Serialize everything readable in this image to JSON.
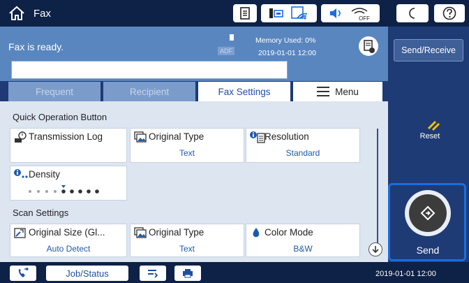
{
  "topbar": {
    "title": "Fax",
    "icons": [
      "home-icon",
      "document-icon",
      "printer-wifi-status-icon",
      "wifi-icon",
      "volume-icon",
      "wifi-off-icon",
      "sleep-moon-icon",
      "help-icon"
    ]
  },
  "status": {
    "message": "Fax is ready.",
    "adf_label": "ADF",
    "memory": "Memory Used: 0%",
    "datetime": "2019-01-01 12:00"
  },
  "tabs": [
    {
      "label": "Frequent",
      "active": false
    },
    {
      "label": "Recipient",
      "active": false
    },
    {
      "label": "Fax Settings",
      "active": true
    },
    {
      "label": "Menu",
      "active": false
    }
  ],
  "quick_ops": {
    "title": "Quick Operation Button",
    "tiles": [
      {
        "title": "Transmission Log",
        "value": ""
      },
      {
        "title": "Original Type",
        "value": "Text"
      },
      {
        "title": "Resolution",
        "value": "Standard"
      },
      {
        "title": "Density",
        "value": ""
      }
    ],
    "density_level": 5,
    "density_steps": 9
  },
  "scan_settings": {
    "title": "Scan Settings",
    "tiles": [
      {
        "title": "Original Size (Gl...",
        "value": "Auto Detect"
      },
      {
        "title": "Original Type",
        "value": "Text"
      },
      {
        "title": "Color Mode",
        "value": "B&W"
      }
    ]
  },
  "right_panel": {
    "send_receive": "Send/Receive",
    "reset": "Reset",
    "send": "Send"
  },
  "bottombar": {
    "job_status": "Job/Status",
    "datetime": "2019-01-01 12:00"
  },
  "colors": {
    "topbar": "#0e2147",
    "status_strip": "#5a86c0",
    "accent_blue": "#1b6de0",
    "value_blue": "#1f5aa8"
  }
}
